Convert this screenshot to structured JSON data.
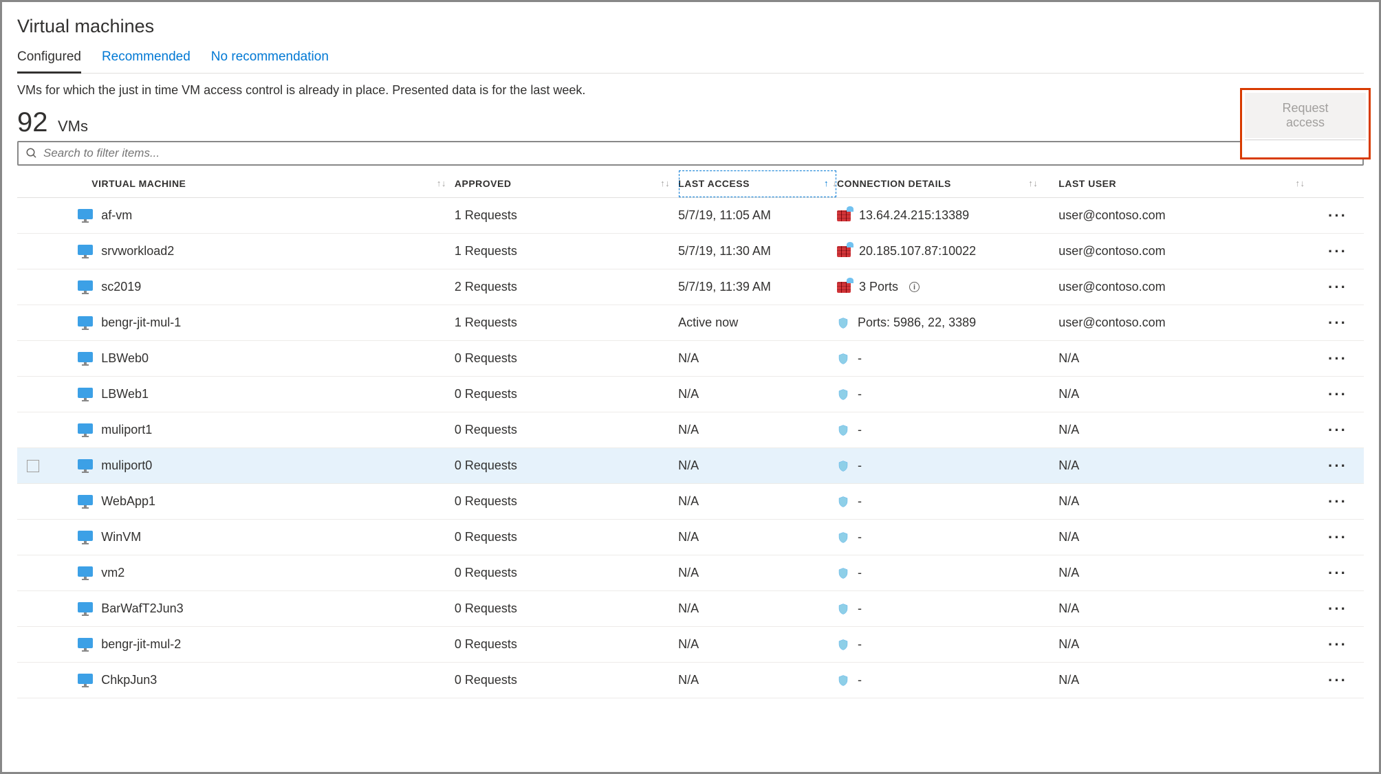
{
  "page": {
    "title": "Virtual machines",
    "description": "VMs for which the just in time VM access control is already in place. Presented data is for the last week.",
    "count": "92",
    "count_label": "VMs",
    "request_button": "Request access",
    "search_placeholder": "Search to filter items..."
  },
  "tabs": [
    {
      "label": "Configured",
      "active": true
    },
    {
      "label": "Recommended",
      "active": false
    },
    {
      "label": "No recommendation",
      "active": false
    }
  ],
  "columns": {
    "vm": "VIRTUAL MACHINE",
    "approved": "APPROVED",
    "last_access": "LAST ACCESS",
    "connection": "CONNECTION DETAILS",
    "user": "LAST USER"
  },
  "rows": [
    {
      "vm": "af-vm",
      "approved": "1 Requests",
      "last": "5/7/19, 11:05 AM",
      "conn_type": "fw",
      "conn": "13.64.24.215:13389",
      "user": "user@contoso.com"
    },
    {
      "vm": "srvworkload2",
      "approved": "1 Requests",
      "last": "5/7/19, 11:30 AM",
      "conn_type": "fw",
      "conn": "20.185.107.87:10022",
      "user": "user@contoso.com"
    },
    {
      "vm": "sc2019",
      "approved": "2 Requests",
      "last": "5/7/19, 11:39 AM",
      "conn_type": "fw",
      "conn": "3 Ports",
      "user": "user@contoso.com",
      "info": true
    },
    {
      "vm": "bengr-jit-mul-1",
      "approved": "1 Requests",
      "last": "Active now",
      "conn_type": "shield",
      "conn": "Ports: 5986, 22, 3389",
      "user": "user@contoso.com"
    },
    {
      "vm": "LBWeb0",
      "approved": "0 Requests",
      "last": "N/A",
      "conn_type": "shield",
      "conn": "-",
      "user": "N/A"
    },
    {
      "vm": "LBWeb1",
      "approved": "0 Requests",
      "last": "N/A",
      "conn_type": "shield",
      "conn": "-",
      "user": "N/A"
    },
    {
      "vm": "muliport1",
      "approved": "0 Requests",
      "last": "N/A",
      "conn_type": "shield",
      "conn": "-",
      "user": "N/A"
    },
    {
      "vm": "muliport0",
      "approved": "0 Requests",
      "last": "N/A",
      "conn_type": "shield",
      "conn": "-",
      "user": "N/A",
      "hover": true
    },
    {
      "vm": "WebApp1",
      "approved": "0 Requests",
      "last": "N/A",
      "conn_type": "shield",
      "conn": "-",
      "user": "N/A"
    },
    {
      "vm": "WinVM",
      "approved": "0 Requests",
      "last": "N/A",
      "conn_type": "shield",
      "conn": "-",
      "user": "N/A"
    },
    {
      "vm": "vm2",
      "approved": "0 Requests",
      "last": "N/A",
      "conn_type": "shield",
      "conn": "-",
      "user": "N/A"
    },
    {
      "vm": "BarWafT2Jun3",
      "approved": "0 Requests",
      "last": "N/A",
      "conn_type": "shield",
      "conn": "-",
      "user": "N/A"
    },
    {
      "vm": "bengr-jit-mul-2",
      "approved": "0 Requests",
      "last": "N/A",
      "conn_type": "shield",
      "conn": "-",
      "user": "N/A"
    },
    {
      "vm": "ChkpJun3",
      "approved": "0 Requests",
      "last": "N/A",
      "conn_type": "shield",
      "conn": "-",
      "user": "N/A"
    }
  ]
}
